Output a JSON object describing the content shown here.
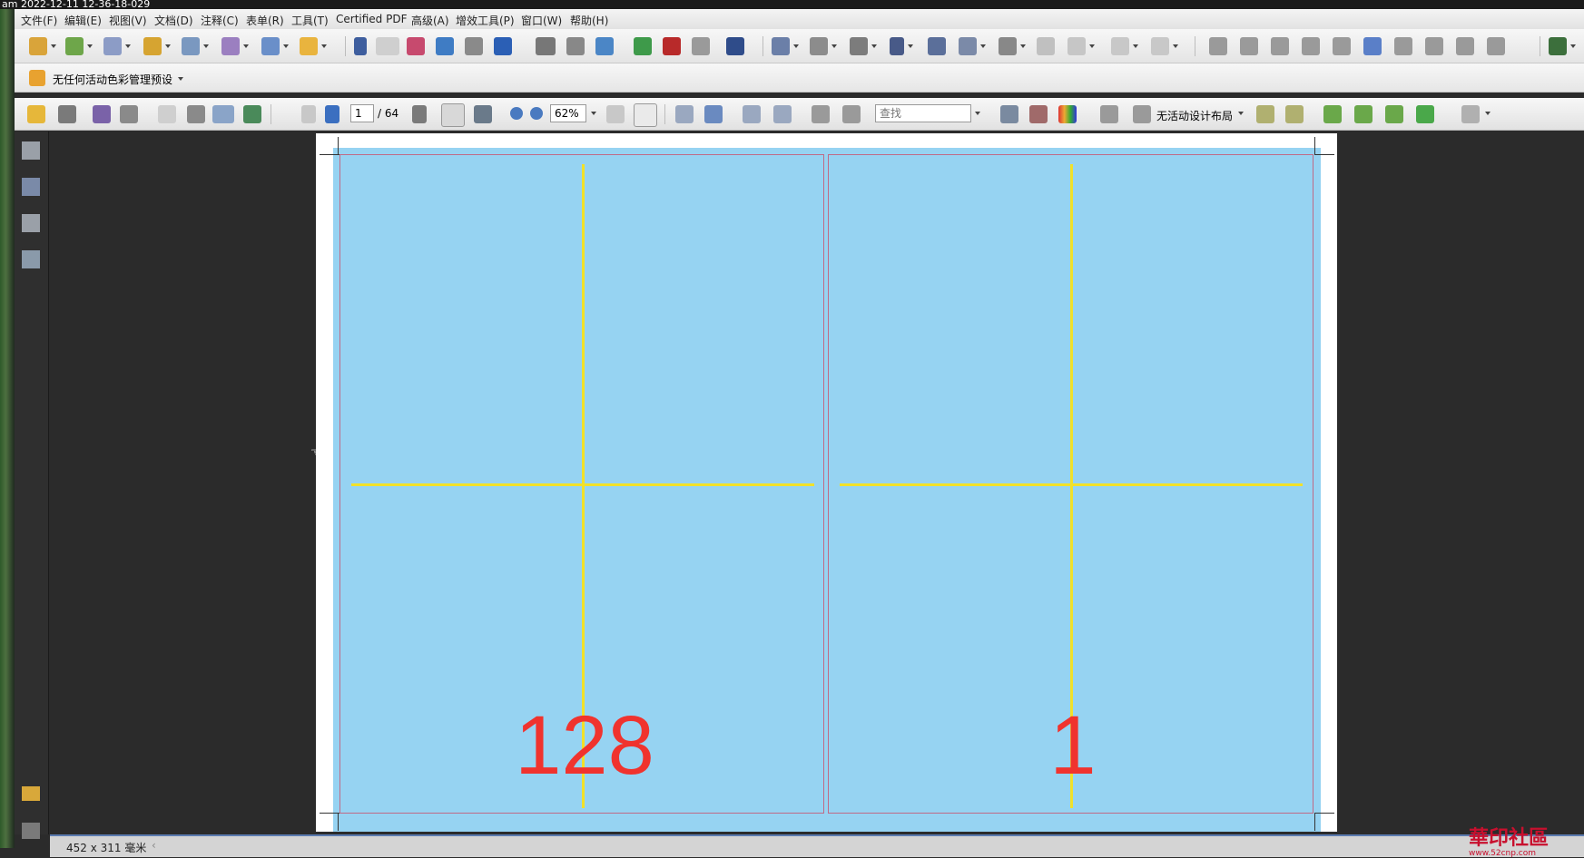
{
  "titlebar": {
    "text": "am 2022-12-11 12-36-18-029"
  },
  "menubar": {
    "items": [
      "文件(F)",
      "编辑(E)",
      "视图(V)",
      "文档(D)",
      "注释(C)",
      "表单(R)",
      "工具(T)",
      "Certified PDF",
      "高级(A)",
      "增效工具(P)",
      "窗口(W)",
      "帮助(H)"
    ]
  },
  "color_toolbar": {
    "label": "无任何活动色彩管理预设"
  },
  "nav_toolbar": {
    "page_current": "1",
    "page_total": "/ 64",
    "zoom": "62%",
    "find_placeholder": "查找",
    "layout_label": "无活动设计布局"
  },
  "document": {
    "left_page_number": "128",
    "right_page_number": "1"
  },
  "statusbar": {
    "dimensions": "452 x 311 毫米"
  },
  "watermark": {
    "text": "華印社區",
    "url": "www.52cnp.com"
  },
  "colors": {
    "page_bg": "#96d3f2",
    "guide": "#f1e12a",
    "page_number": "#f0332e",
    "cell_border": "#c06a86"
  }
}
